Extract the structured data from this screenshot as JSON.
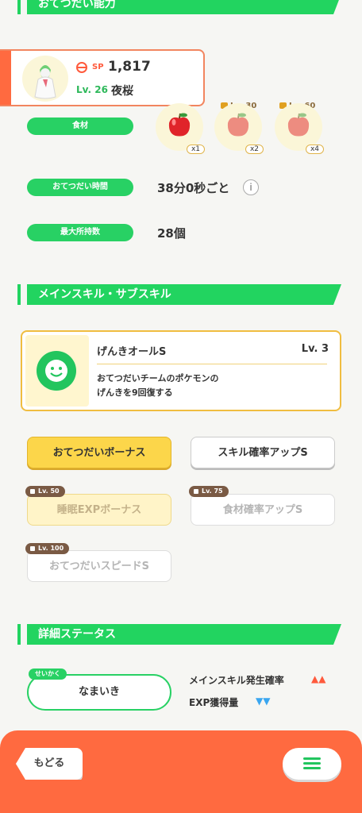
{
  "ability_section": {
    "title": "おてつだい能力"
  },
  "pokemon_card": {
    "sp_label": "SP",
    "sp_value": "1,817",
    "level": "Lv. 26",
    "nickname": "夜桜"
  },
  "ingredients": {
    "label": "食材",
    "items": [
      {
        "lock_level": "",
        "mult": "x1",
        "locked": false
      },
      {
        "lock_level": "Lv. 30",
        "mult": "x2",
        "locked": true
      },
      {
        "lock_level": "Lv. 60",
        "mult": "x4",
        "locked": true
      }
    ]
  },
  "help_time": {
    "label": "おてつだい時間",
    "value": "38分0秒ごと",
    "info_icon": "info-icon"
  },
  "max_carry": {
    "label": "最大所持数",
    "value": "28個"
  },
  "skill_section": {
    "title": "メインスキル・サブスキル"
  },
  "main_skill": {
    "name": "げんきオールS",
    "level": "Lv. 3",
    "desc_line1": "おてつだいチームのポケモンの",
    "desc_line2": "げんきを9回復する"
  },
  "sub_skills": [
    {
      "label": "おてつだいボーナス",
      "lock_level": "",
      "state": "active-gold"
    },
    {
      "label": "スキル確率アップS",
      "lock_level": "",
      "state": "active-white"
    },
    {
      "label": "睡眠EXPボーナス",
      "lock_level": "Lv. 50",
      "state": "locked-gold"
    },
    {
      "label": "食材確率アップS",
      "lock_level": "Lv. 75",
      "state": "locked-white"
    },
    {
      "label": "おてつだいスピードS",
      "lock_level": "Lv. 100",
      "state": "locked-white"
    }
  ],
  "detail_section": {
    "title": "詳細ステータス"
  },
  "nature": {
    "tag": "せいかく",
    "value": "なまいき",
    "up_label": "メインスキル発生確率",
    "up_marks": "▲▲",
    "down_label": "EXP獲得量",
    "down_marks": "▼▼"
  },
  "colors": {
    "accent_green": "#22d460",
    "bottom_orange": "#ff6a40",
    "up_red": "#ff5a3c",
    "down_blue": "#3aa6f0"
  },
  "nav": {
    "back_label": "もどる",
    "menu_icon": "hamburger-icon"
  }
}
